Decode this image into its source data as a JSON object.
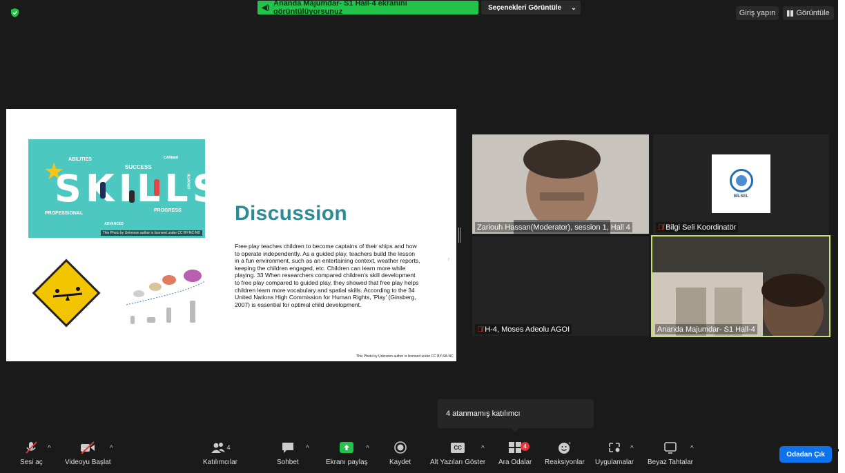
{
  "share_banner": {
    "text": "Ananda Majumdar- S1 Hall-4 ekranını görüntülüyorsunuz"
  },
  "view_options": {
    "label": "Seçenekleri Görüntüle"
  },
  "top_right": {
    "signin": "Giriş yapın",
    "view": "Görüntüle"
  },
  "slide": {
    "image_text": {
      "skills": "SKILLS",
      "abilities": "ABILITIES",
      "success": "SUCCESS",
      "career": "CAREER",
      "growth": "GROWTH",
      "professional": "PROFESSIONAL",
      "advanced": "ADVANCED",
      "progress": "PROGRESS"
    },
    "image_credit": "This Photo by Unknown author is licensed under CC BY-NC-ND",
    "title": "Discussion",
    "body": "Free play teaches children to become captains of their ships and how to operate independently. As a guided play, teachers build the lesson in a fun environment, such as an entertaining context, weather reports, keeping the children engaged, etc. Children can learn more while playing. 33 When researchers compared children's skill development to free play compared to guided play, they showed that free play helps children learn more vocabulary and spatial skills. According to the 34 United Nations High Commission for Human Rights, 'Play' (Ginsberg, 2007) is essential for optimal child development.",
    "credit": "This Photo by Unknown author is licensed under CC BY-SA-NC"
  },
  "participants": [
    {
      "name": "Zariouh Hassan(Moderator), session 1, Hall 4",
      "muted": false
    },
    {
      "name": "Bilgi Seli Koordinatör",
      "muted": true,
      "logo_text": "BİLSEL"
    },
    {
      "name": "H-4, Moses Adeolu AGOI",
      "muted": true
    },
    {
      "name": "Ananda Majumdar- S1 Hall-4",
      "muted": false,
      "active_speaker": true
    }
  ],
  "tooltip": {
    "text": "4 atanmamış katılımcı"
  },
  "toolbar": {
    "audio": "Sesi aç",
    "video": "Videoyu Başlat",
    "participants": "Katılımcılar",
    "participants_count": "4",
    "chat": "Sohbet",
    "share": "Ekranı paylaş",
    "record": "Kaydet",
    "captions": "Alt Yazıları Göster",
    "captions_icon": "CC",
    "breakout": "Ara Odalar",
    "breakout_badge": "4",
    "reactions": "Reaksiyonlar",
    "apps": "Uygulamalar",
    "whiteboard": "Beyaz Tahtalar",
    "leave": "Odadan Çık"
  },
  "colors": {
    "share_green": "#23c24a",
    "leave_blue": "#0e72ed",
    "active_border": "#c6e26a",
    "slide_title": "#2e8b95",
    "badge_red": "#e8353a"
  },
  "trailing_mark": ","
}
